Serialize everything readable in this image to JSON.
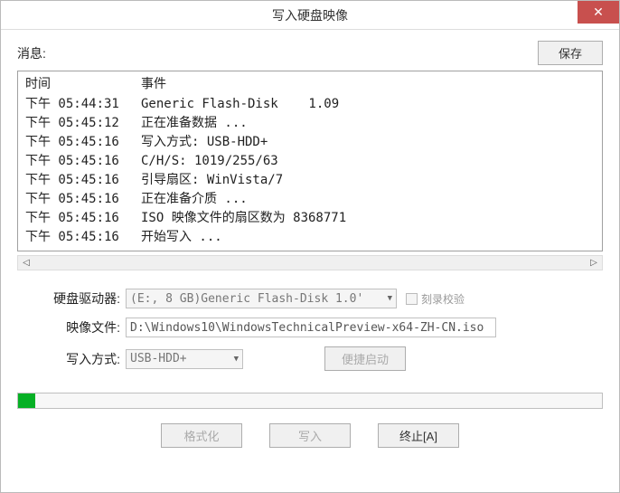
{
  "window": {
    "title": "写入硬盘映像",
    "close": "✕"
  },
  "toolbar": {
    "message_label": "消息:",
    "save_label": "保存"
  },
  "log": {
    "header_time": "时间",
    "header_event": "事件",
    "rows": [
      {
        "time": "下午 05:44:31",
        "event": "Generic Flash-Disk    1.09"
      },
      {
        "time": "下午 05:45:12",
        "event": "正在准备数据 ..."
      },
      {
        "time": "下午 05:45:16",
        "event": "写入方式: USB-HDD+"
      },
      {
        "time": "下午 05:45:16",
        "event": "C/H/S: 1019/255/63"
      },
      {
        "time": "下午 05:45:16",
        "event": "引导扇区: WinVista/7"
      },
      {
        "time": "下午 05:45:16",
        "event": "正在准备介质 ..."
      },
      {
        "time": "下午 05:45:16",
        "event": "ISO 映像文件的扇区数为 8368771"
      },
      {
        "time": "下午 05:45:16",
        "event": "开始写入 ..."
      }
    ]
  },
  "form": {
    "disk_label": "硬盘驱动器:",
    "disk_value": "(E:, 8 GB)Generic Flash-Disk    1.0'",
    "verify_label": "刻录校验",
    "image_label": "映像文件:",
    "image_value": "D:\\Windows10\\WindowsTechnicalPreview-x64-ZH-CN.iso",
    "mode_label": "写入方式:",
    "mode_value": "USB-HDD+",
    "boot_button": "便捷启动"
  },
  "progress": {
    "percent": 3
  },
  "buttons": {
    "format": "格式化",
    "write": "写入",
    "abort": "终止[A]"
  },
  "colors": {
    "accent_red": "#c8504e",
    "progress_green": "#06b025"
  }
}
